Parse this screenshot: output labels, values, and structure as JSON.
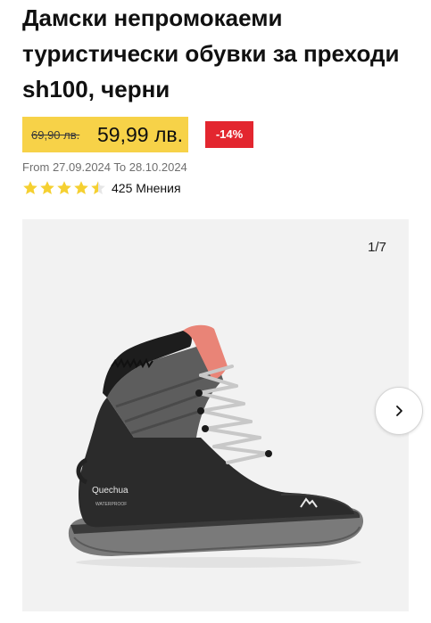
{
  "product": {
    "title": "Дамски непромокаеми туристически обувки за преходи sh100, черни",
    "old_price": "69,90 лв.",
    "new_price": "59,99 лв.",
    "discount": "-14%",
    "date_range": "From 27.09.2024 To 28.10.2024",
    "rating": 4.5,
    "rating_max": 5,
    "reviews_label": "425 Мнения"
  },
  "gallery": {
    "counter": "1/7",
    "current_image": 1,
    "total_images": 7,
    "next_icon": "chevron-right-icon",
    "logo_text": "Quechua",
    "badge_text": "WATERPROOF"
  },
  "colors": {
    "price_box": "#f7d248",
    "discount_badge": "#e3262f",
    "star": "#f5d031",
    "gallery_bg": "#f2f2f2"
  }
}
